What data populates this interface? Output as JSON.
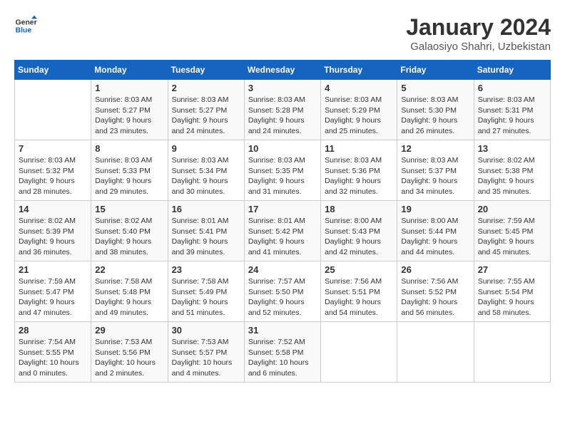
{
  "logo": {
    "line1": "General",
    "line2": "Blue"
  },
  "title": "January 2024",
  "subtitle": "Galaosiyo Shahri, Uzbekistan",
  "days_header": [
    "Sunday",
    "Monday",
    "Tuesday",
    "Wednesday",
    "Thursday",
    "Friday",
    "Saturday"
  ],
  "weeks": [
    [
      {
        "day": "",
        "info": ""
      },
      {
        "day": "1",
        "info": "Sunrise: 8:03 AM\nSunset: 5:27 PM\nDaylight: 9 hours\nand 23 minutes."
      },
      {
        "day": "2",
        "info": "Sunrise: 8:03 AM\nSunset: 5:27 PM\nDaylight: 9 hours\nand 24 minutes."
      },
      {
        "day": "3",
        "info": "Sunrise: 8:03 AM\nSunset: 5:28 PM\nDaylight: 9 hours\nand 24 minutes."
      },
      {
        "day": "4",
        "info": "Sunrise: 8:03 AM\nSunset: 5:29 PM\nDaylight: 9 hours\nand 25 minutes."
      },
      {
        "day": "5",
        "info": "Sunrise: 8:03 AM\nSunset: 5:30 PM\nDaylight: 9 hours\nand 26 minutes."
      },
      {
        "day": "6",
        "info": "Sunrise: 8:03 AM\nSunset: 5:31 PM\nDaylight: 9 hours\nand 27 minutes."
      }
    ],
    [
      {
        "day": "7",
        "info": "Sunrise: 8:03 AM\nSunset: 5:32 PM\nDaylight: 9 hours\nand 28 minutes."
      },
      {
        "day": "8",
        "info": "Sunrise: 8:03 AM\nSunset: 5:33 PM\nDaylight: 9 hours\nand 29 minutes."
      },
      {
        "day": "9",
        "info": "Sunrise: 8:03 AM\nSunset: 5:34 PM\nDaylight: 9 hours\nand 30 minutes."
      },
      {
        "day": "10",
        "info": "Sunrise: 8:03 AM\nSunset: 5:35 PM\nDaylight: 9 hours\nand 31 minutes."
      },
      {
        "day": "11",
        "info": "Sunrise: 8:03 AM\nSunset: 5:36 PM\nDaylight: 9 hours\nand 32 minutes."
      },
      {
        "day": "12",
        "info": "Sunrise: 8:03 AM\nSunset: 5:37 PM\nDaylight: 9 hours\nand 34 minutes."
      },
      {
        "day": "13",
        "info": "Sunrise: 8:02 AM\nSunset: 5:38 PM\nDaylight: 9 hours\nand 35 minutes."
      }
    ],
    [
      {
        "day": "14",
        "info": "Sunrise: 8:02 AM\nSunset: 5:39 PM\nDaylight: 9 hours\nand 36 minutes."
      },
      {
        "day": "15",
        "info": "Sunrise: 8:02 AM\nSunset: 5:40 PM\nDaylight: 9 hours\nand 38 minutes."
      },
      {
        "day": "16",
        "info": "Sunrise: 8:01 AM\nSunset: 5:41 PM\nDaylight: 9 hours\nand 39 minutes."
      },
      {
        "day": "17",
        "info": "Sunrise: 8:01 AM\nSunset: 5:42 PM\nDaylight: 9 hours\nand 41 minutes."
      },
      {
        "day": "18",
        "info": "Sunrise: 8:00 AM\nSunset: 5:43 PM\nDaylight: 9 hours\nand 42 minutes."
      },
      {
        "day": "19",
        "info": "Sunrise: 8:00 AM\nSunset: 5:44 PM\nDaylight: 9 hours\nand 44 minutes."
      },
      {
        "day": "20",
        "info": "Sunrise: 7:59 AM\nSunset: 5:45 PM\nDaylight: 9 hours\nand 45 minutes."
      }
    ],
    [
      {
        "day": "21",
        "info": "Sunrise: 7:59 AM\nSunset: 5:47 PM\nDaylight: 9 hours\nand 47 minutes."
      },
      {
        "day": "22",
        "info": "Sunrise: 7:58 AM\nSunset: 5:48 PM\nDaylight: 9 hours\nand 49 minutes."
      },
      {
        "day": "23",
        "info": "Sunrise: 7:58 AM\nSunset: 5:49 PM\nDaylight: 9 hours\nand 51 minutes."
      },
      {
        "day": "24",
        "info": "Sunrise: 7:57 AM\nSunset: 5:50 PM\nDaylight: 9 hours\nand 52 minutes."
      },
      {
        "day": "25",
        "info": "Sunrise: 7:56 AM\nSunset: 5:51 PM\nDaylight: 9 hours\nand 54 minutes."
      },
      {
        "day": "26",
        "info": "Sunrise: 7:56 AM\nSunset: 5:52 PM\nDaylight: 9 hours\nand 56 minutes."
      },
      {
        "day": "27",
        "info": "Sunrise: 7:55 AM\nSunset: 5:54 PM\nDaylight: 9 hours\nand 58 minutes."
      }
    ],
    [
      {
        "day": "28",
        "info": "Sunrise: 7:54 AM\nSunset: 5:55 PM\nDaylight: 10 hours\nand 0 minutes."
      },
      {
        "day": "29",
        "info": "Sunrise: 7:53 AM\nSunset: 5:56 PM\nDaylight: 10 hours\nand 2 minutes."
      },
      {
        "day": "30",
        "info": "Sunrise: 7:53 AM\nSunset: 5:57 PM\nDaylight: 10 hours\nand 4 minutes."
      },
      {
        "day": "31",
        "info": "Sunrise: 7:52 AM\nSunset: 5:58 PM\nDaylight: 10 hours\nand 6 minutes."
      },
      {
        "day": "",
        "info": ""
      },
      {
        "day": "",
        "info": ""
      },
      {
        "day": "",
        "info": ""
      }
    ]
  ]
}
